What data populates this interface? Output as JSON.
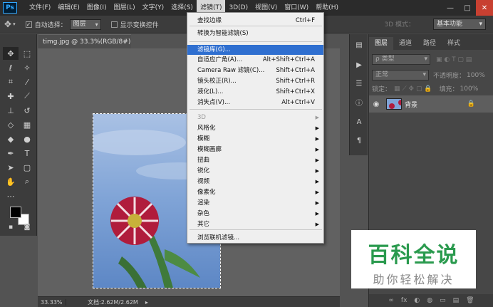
{
  "app": {
    "logo": "Ps"
  },
  "menubar": {
    "items": [
      "文件(F)",
      "编辑(E)",
      "图像(I)",
      "图层(L)",
      "文字(Y)",
      "选择(S)",
      "滤镜(T)",
      "3D(D)",
      "视图(V)",
      "窗口(W)",
      "帮助(H)"
    ],
    "active_index": 6
  },
  "window_controls": {
    "minimize": "—",
    "maximize": "□",
    "close": "✕"
  },
  "options_bar": {
    "tool_icon": "move-icon",
    "auto_select_label": "自动选择：",
    "auto_select_checked": true,
    "auto_select_value": "图层",
    "show_transform_label": "显示变换控件",
    "mode_3d_label": "3D 模式：",
    "workspace": "基本功能"
  },
  "document": {
    "tab_title": "timg.jpg @ 33.3%(RGB/8#) *",
    "close": "×",
    "zoom": "33.33%",
    "doc_size": "文档:2.62M/2.62M",
    "status_arrow": "▸"
  },
  "filter_menu": {
    "items": [
      {
        "label": "查找边缘",
        "shortcut": "Ctrl+F"
      },
      {
        "label": "转换为智能滤镜(S)"
      },
      {
        "label": "滤镜库(G)...",
        "highlight": true
      },
      {
        "label": "自适应广角(A)...",
        "shortcut": "Alt+Shift+Ctrl+A"
      },
      {
        "label": "Camera Raw 滤镜(C)...",
        "shortcut": "Shift+Ctrl+A"
      },
      {
        "label": "镜头校正(R)...",
        "shortcut": "Shift+Ctrl+R"
      },
      {
        "label": "液化(L)...",
        "shortcut": "Shift+Ctrl+X"
      },
      {
        "label": "消失点(V)...",
        "shortcut": "Alt+Ctrl+V"
      },
      {
        "label": "3D",
        "submenu": true,
        "disabled": true
      },
      {
        "label": "风格化",
        "submenu": true
      },
      {
        "label": "模糊",
        "submenu": true
      },
      {
        "label": "模糊画廊",
        "submenu": true
      },
      {
        "label": "扭曲",
        "submenu": true
      },
      {
        "label": "锐化",
        "submenu": true
      },
      {
        "label": "视频",
        "submenu": true
      },
      {
        "label": "像素化",
        "submenu": true
      },
      {
        "label": "渲染",
        "submenu": true
      },
      {
        "label": "杂色",
        "submenu": true
      },
      {
        "label": "其它",
        "submenu": true
      },
      {
        "label": "浏览联机滤镜..."
      }
    ]
  },
  "layers_panel": {
    "tabs": [
      "图层",
      "通道",
      "路径",
      "样式"
    ],
    "active_tab": 0,
    "kind_filter": "ρ 类型",
    "blend_mode": "正常",
    "opacity_label": "不透明度：",
    "opacity_value": "100%",
    "lock_label": "锁定：",
    "fill_label": "填充：",
    "fill_value": "100%",
    "layer": {
      "name": "背景",
      "visible": true,
      "locked": true
    },
    "footer_icons": [
      "∞",
      "fx",
      "◐",
      "◍",
      "▭",
      "▤",
      "🗑"
    ]
  },
  "watermark": {
    "title": "百科全说",
    "subtitle": "助你轻松解决"
  },
  "colors": {
    "menu_highlight": "#2f6fd0",
    "watermark_green": "#2a9a4e",
    "sky": "#7fa3d6",
    "petal": "#b01c3c"
  }
}
